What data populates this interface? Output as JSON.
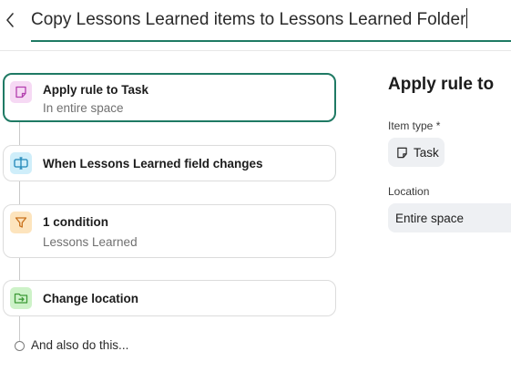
{
  "header": {
    "title_value": "Copy Lessons Learned items to Lessons Learned Folder",
    "accent_color": "#1f7a64"
  },
  "steps": [
    {
      "title": "Apply rule to Task",
      "subtitle": "In entire space",
      "icon": "note-icon",
      "icon_bg": "#f6d9f4"
    },
    {
      "title": "When Lessons Learned field changes",
      "subtitle": "",
      "icon": "field-change-icon",
      "icon_bg": "#cfeefa"
    },
    {
      "title": "1 condition",
      "subtitle": "Lessons Learned",
      "icon": "filter-icon",
      "icon_bg": "#fde4bd"
    },
    {
      "title": "Change location",
      "subtitle": "",
      "icon": "folder-move-icon",
      "icon_bg": "#cdf2c8"
    }
  ],
  "add_action_label": "And also do this...",
  "panel": {
    "title": "Apply rule to",
    "item_type_label": "Item type *",
    "item_type_value": "Task",
    "location_label": "Location",
    "location_value": "Entire space"
  }
}
